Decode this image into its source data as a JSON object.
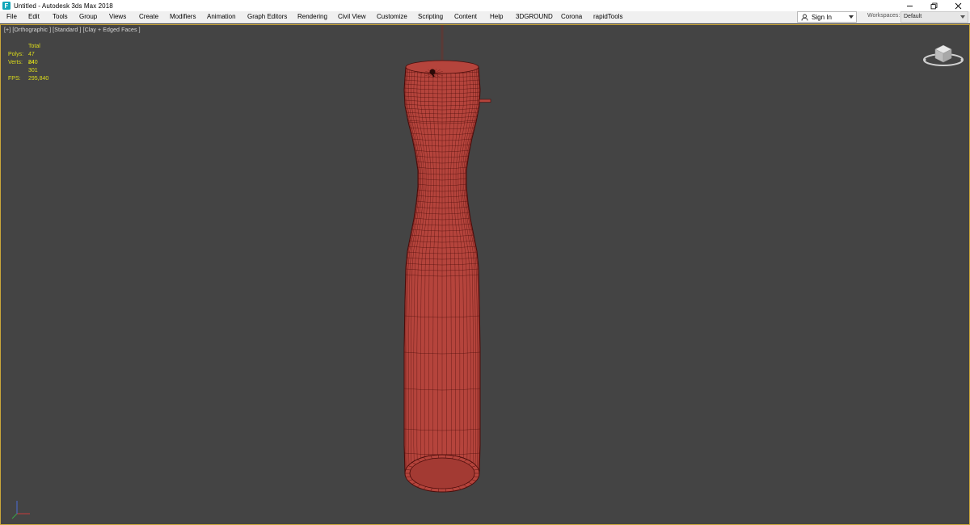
{
  "window": {
    "title": "Untitled - Autodesk 3ds Max 2018",
    "app_icon": "3dsmax-icon",
    "controls": [
      "minimize-icon",
      "restore-icon",
      "close-icon"
    ]
  },
  "menu": {
    "items": [
      "File",
      "Edit",
      "Tools",
      "Group",
      "Views",
      "Create",
      "Modifiers",
      "Animation",
      "Graph Editors",
      "Rendering",
      "Civil View",
      "Customize",
      "Scripting",
      "Content",
      "Help",
      "3DGROUND",
      "Corona",
      "rapidTools"
    ],
    "signin_label": "Sign In",
    "workspaces_label": "Workspaces:",
    "workspace_value": "Default"
  },
  "viewport": {
    "label": "[+] [Orthographic ] [Standard ] [Clay + Edged Faces ]",
    "stats": {
      "total_label": "Total",
      "polys_label": "Polys:",
      "polys_value": "47 840",
      "verts_label": "Verts:",
      "verts_value": "24 301",
      "fps_label": "FPS:",
      "fps_value": "295,840"
    },
    "model_color": "#b5443c",
    "wire_color": "#4a0c0a",
    "stats_color": "#dede1a",
    "border_color": "#caa63a",
    "background_color": "#444444"
  }
}
